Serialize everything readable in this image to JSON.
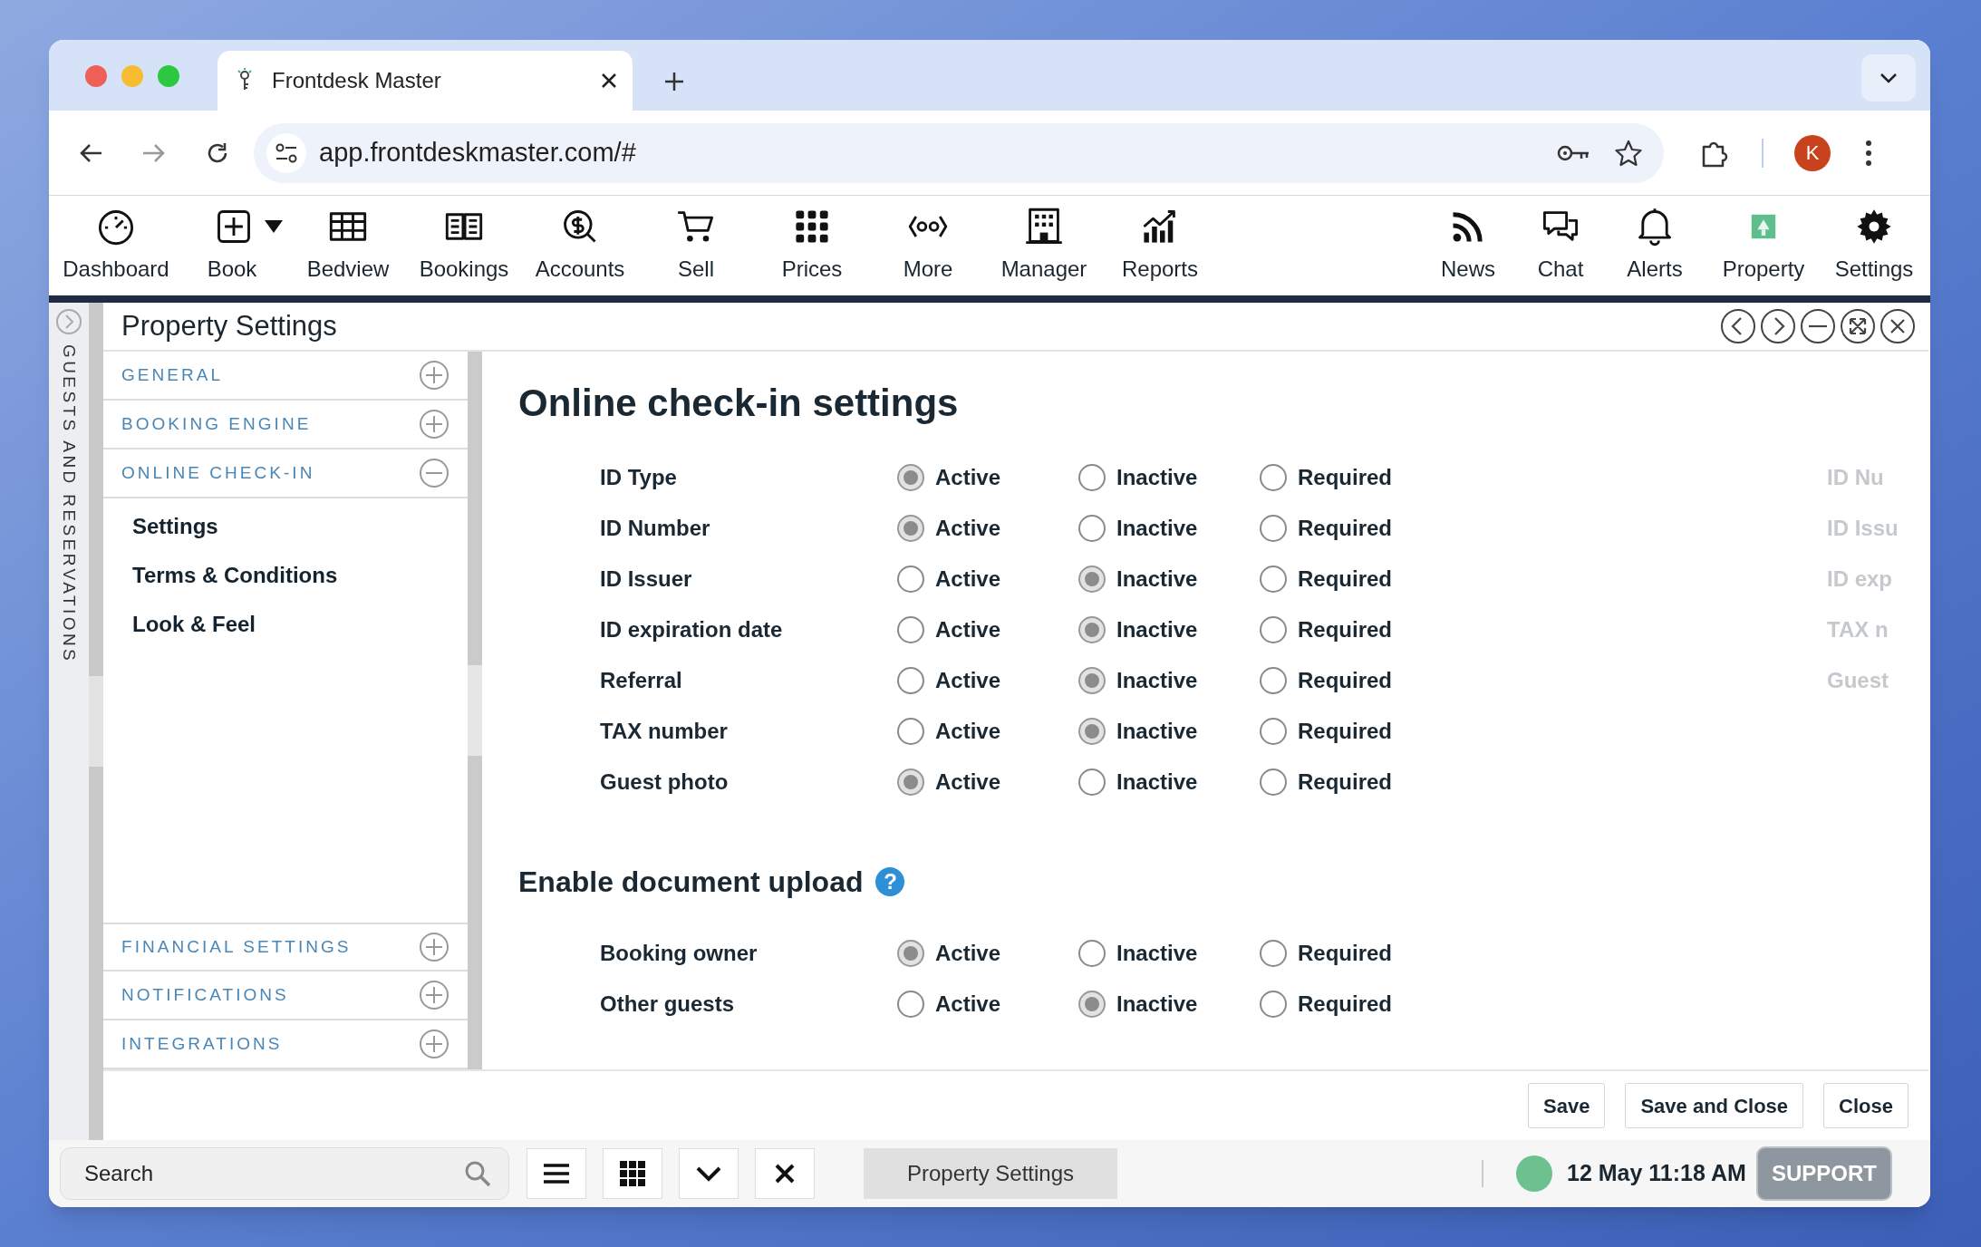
{
  "browser": {
    "tab_title": "Frontdesk Master",
    "url": "app.frontdeskmaster.com/#",
    "profile_initial": "K"
  },
  "toolbar": {
    "left_items": [
      {
        "label": "Dashboard"
      },
      {
        "label": "Book",
        "has_menu": true
      },
      {
        "label": "Bedview"
      },
      {
        "label": "Bookings"
      },
      {
        "label": "Accounts"
      },
      {
        "label": "Sell"
      },
      {
        "label": "Prices"
      },
      {
        "label": "More"
      },
      {
        "label": "Manager"
      },
      {
        "label": "Reports"
      }
    ],
    "right_items": [
      {
        "label": "News"
      },
      {
        "label": "Chat"
      },
      {
        "label": "Alerts"
      },
      {
        "label": "Property"
      },
      {
        "label": "Settings"
      }
    ]
  },
  "side_strip": {
    "label": "GUESTS AND RESERVATIONS"
  },
  "panel": {
    "title": "Property Settings",
    "nav": [
      {
        "label": "GENERAL",
        "expanded": false
      },
      {
        "label": "BOOKING ENGINE",
        "expanded": false
      },
      {
        "label": "ONLINE CHECK-IN",
        "expanded": true,
        "children": [
          {
            "label": "Settings"
          },
          {
            "label": "Terms & Conditions"
          },
          {
            "label": "Look & Feel"
          }
        ]
      },
      {
        "label": "FINANCIAL SETTINGS",
        "expanded": false
      },
      {
        "label": "NOTIFICATIONS",
        "expanded": false
      },
      {
        "label": "INTEGRATIONS",
        "expanded": false
      }
    ],
    "sections": [
      {
        "title": "Online check-in settings",
        "rows": [
          {
            "label": "ID Type",
            "options": [
              {
                "label": "Active",
                "selected": true
              },
              {
                "label": "Inactive",
                "selected": false
              },
              {
                "label": "Required",
                "selected": false
              }
            ],
            "faded_label": "ID Nu"
          },
          {
            "label": "ID Number",
            "options": [
              {
                "label": "Active",
                "selected": true
              },
              {
                "label": "Inactive",
                "selected": false
              },
              {
                "label": "Required",
                "selected": false
              }
            ],
            "faded_label": "ID Issu"
          },
          {
            "label": "ID Issuer",
            "options": [
              {
                "label": "Active",
                "selected": false
              },
              {
                "label": "Inactive",
                "selected": true
              },
              {
                "label": "Required",
                "selected": false
              }
            ],
            "faded_label": "ID exp"
          },
          {
            "label": "ID expiration date",
            "options": [
              {
                "label": "Active",
                "selected": false
              },
              {
                "label": "Inactive",
                "selected": true
              },
              {
                "label": "Required",
                "selected": false
              }
            ],
            "faded_label": "TAX n"
          },
          {
            "label": "Referral",
            "options": [
              {
                "label": "Active",
                "selected": false
              },
              {
                "label": "Inactive",
                "selected": true
              },
              {
                "label": "Required",
                "selected": false
              }
            ],
            "faded_label": "Guest"
          },
          {
            "label": "TAX number",
            "options": [
              {
                "label": "Active",
                "selected": false
              },
              {
                "label": "Inactive",
                "selected": true
              },
              {
                "label": "Required",
                "selected": false
              }
            ]
          },
          {
            "label": "Guest photo",
            "options": [
              {
                "label": "Active",
                "selected": true
              },
              {
                "label": "Inactive",
                "selected": false
              },
              {
                "label": "Required",
                "selected": false
              }
            ]
          }
        ]
      },
      {
        "title": "Enable document upload",
        "help_icon": "?",
        "rows": [
          {
            "label": "Booking owner",
            "options": [
              {
                "label": "Active",
                "selected": true
              },
              {
                "label": "Inactive",
                "selected": false
              },
              {
                "label": "Required",
                "selected": false
              }
            ]
          },
          {
            "label": "Other guests",
            "options": [
              {
                "label": "Active",
                "selected": false
              },
              {
                "label": "Inactive",
                "selected": true
              },
              {
                "label": "Required",
                "selected": false
              }
            ]
          }
        ]
      }
    ],
    "buttons": [
      {
        "label": "Save"
      },
      {
        "label": "Save and Close"
      },
      {
        "label": "Close"
      }
    ]
  },
  "taskbar": {
    "search": {
      "placeholder": "Search"
    },
    "task_tab": "Property Settings",
    "status": {
      "color": "#6cc18f"
    },
    "datetime": "12 May 11:18 AM",
    "support": "SUPPORT"
  }
}
